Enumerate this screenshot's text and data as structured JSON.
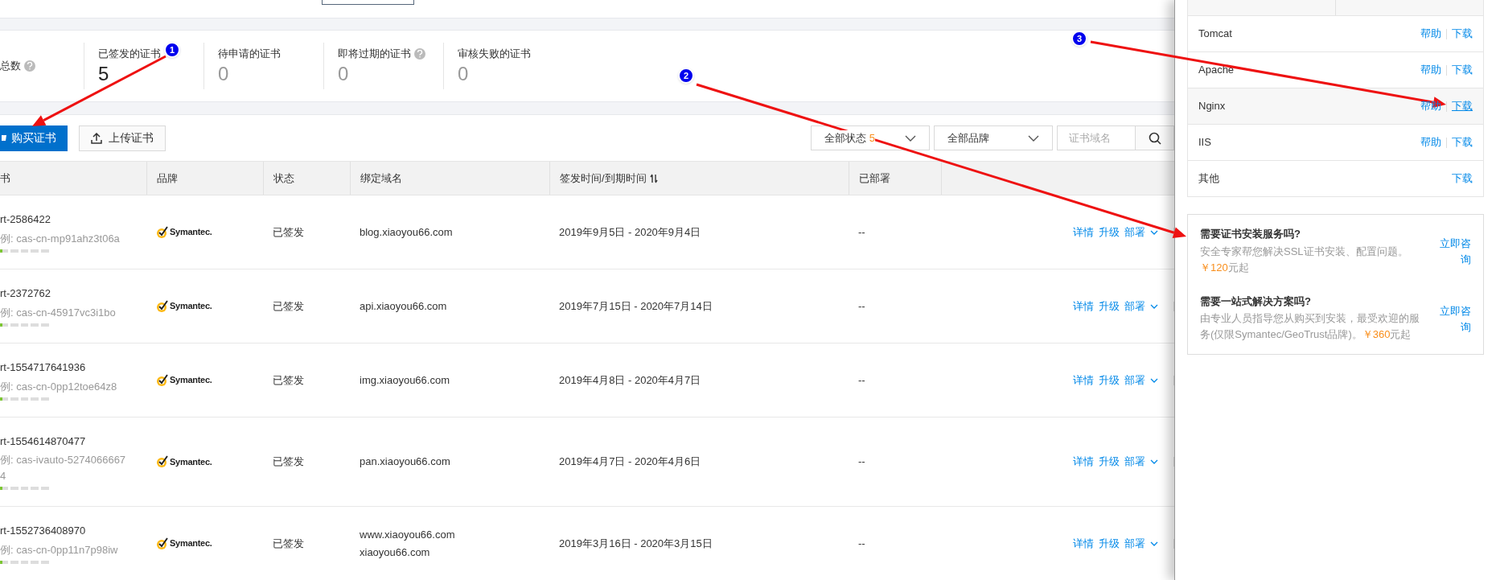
{
  "stats": [
    {
      "label": "总数",
      "help": true
    },
    {
      "label": "已签发的证书",
      "help": false,
      "value": "5"
    },
    {
      "label": "待申请的证书",
      "help": false,
      "value": "0"
    },
    {
      "label": "即将过期的证书",
      "help": true,
      "value": "0"
    },
    {
      "label": "审核失败的证书",
      "help": false,
      "value": "0"
    }
  ],
  "toolbar": {
    "buy_button": "购买证书",
    "upload_button": "上传证书",
    "status_filter": {
      "label": "全部状态",
      "count": "5"
    },
    "brand_filter": "全部品牌",
    "search": {
      "placeholder": "证书域名"
    }
  },
  "table": {
    "columns": [
      "书",
      "品牌",
      "状态",
      "绑定域名",
      "签发时间/到期时间",
      "已部署",
      ""
    ],
    "rows": [
      {
        "name": "rt-2586422",
        "instance": "例: cas-cn-mp91ahz3t06a",
        "level": 0.05,
        "brand": "Symantec.",
        "status": "已签发",
        "domains": [
          "blog.xiaoyou66.com"
        ],
        "period": "2019年9月5日 - 2020年9月4日",
        "deployed": "--",
        "actions": [
          "详情",
          "升级",
          "部署"
        ]
      },
      {
        "name": "rt-2372762",
        "instance": "例: cas-cn-45917vc3i1bo",
        "level": 0.05,
        "brand": "Symantec.",
        "status": "已签发",
        "domains": [
          "api.xiaoyou66.com"
        ],
        "period": "2019年7月15日 - 2020年7月14日",
        "deployed": "--",
        "actions": [
          "详情",
          "升级",
          "部署"
        ]
      },
      {
        "name": "rt-1554717641936",
        "instance": "例: cas-cn-0pp12toe64z8",
        "level": 0.05,
        "brand": "Symantec.",
        "status": "已签发",
        "domains": [
          "img.xiaoyou66.com"
        ],
        "period": "2019年4月8日 - 2020年4月7日",
        "deployed": "--",
        "actions": [
          "详情",
          "升级",
          "部署"
        ]
      },
      {
        "name": "rt-1554614870477",
        "instance": "例: cas-ivauto-52740666674",
        "level": 0.05,
        "brand": "Symantec.",
        "status": "已签发",
        "domains": [
          "pan.xiaoyou66.com"
        ],
        "period": "2019年4月7日 - 2020年4月6日",
        "deployed": "--",
        "actions": [
          "详情",
          "升级",
          "部署"
        ]
      },
      {
        "name": "rt-1552736408970",
        "instance": "例: cas-cn-0pp11n7p98iw",
        "level": 0.05,
        "brand": "Symantec.",
        "status": "已签发",
        "domains": [
          "www.xiaoyou66.com",
          "xiaoyou66.com"
        ],
        "period": "2019年3月16日 - 2020年3月15日",
        "deployed": "--",
        "actions": [
          "详情",
          "升级",
          "部署"
        ]
      }
    ]
  },
  "drawer": {
    "servers": [
      {
        "name": "Tomcat",
        "help": "帮助",
        "download": "下载",
        "hovered": false
      },
      {
        "name": "Apache",
        "help": "帮助",
        "download": "下载",
        "hovered": false
      },
      {
        "name": "Nginx",
        "help": "帮助",
        "download": "下载",
        "hovered": true
      },
      {
        "name": "IIS",
        "help": "帮助",
        "download": "下载",
        "hovered": false
      },
      {
        "name": "其他",
        "download": "下载",
        "hovered": false
      }
    ],
    "services": [
      {
        "title": "需要证书安装服务吗?",
        "desc": "安全专家帮您解决SSL证书安装、配置问题。",
        "price": "￥120",
        "suffix": "元起",
        "action": "立即咨询"
      },
      {
        "title": "需要一站式解决方案吗?",
        "desc": "由专业人员指导您从购买到安装，最受欢迎的服务(仅限Symantec/GeoTrust品牌)。",
        "price": "￥360",
        "suffix": "元起",
        "action": "立即咨询"
      }
    ]
  },
  "annotations": [
    {
      "number": "1"
    },
    {
      "number": "2"
    },
    {
      "number": "3"
    }
  ]
}
